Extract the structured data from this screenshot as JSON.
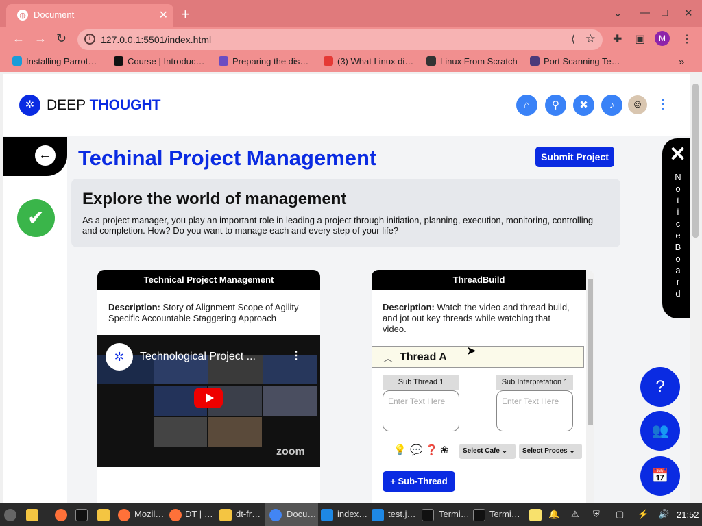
{
  "browser": {
    "tab_title": "Document",
    "url": "127.0.0.1:5501/index.html",
    "profile_initial": "M",
    "bookmarks": [
      "Installing Parrot…",
      "Course | Introduc…",
      "Preparing the dis…",
      "(3) What Linux di…",
      "Linux From Scratch",
      "Port Scanning Te…"
    ]
  },
  "header": {
    "brand_first": "DEEP",
    "brand_second": "THOUGHT"
  },
  "main": {
    "title": "Techinal Project Management",
    "submit_label": "Submit Project",
    "explore_heading": "Explore the world of management",
    "explore_text": "As a project manager, you play an important role in leading a project through initiation, planning, execution, monitoring, controlling and completion. How? Do you want to manage each and every step of your life?"
  },
  "card1": {
    "title": "Technical Project Management",
    "desc_label": "Description:",
    "desc_text": "Story of Alignment Scope of Agility Specific Accountable Staggering Approach",
    "video_title": "Technological Project ...",
    "video_brand": "zoom"
  },
  "card2": {
    "title": "ThreadBuild",
    "desc_label": "Description:",
    "desc_text": "Watch the video and thread build, and jot out key threads while watching that video.",
    "thread_title": "Thread A",
    "sub_thread_label": "Sub Thread 1",
    "sub_interp_label": "Sub Interpretation 1",
    "placeholder": "Enter Text Here",
    "select_cafe": "Select Cafe",
    "select_process": "Select Proces",
    "add_sub_thread": "+ Sub-Thread"
  },
  "notice_board": {
    "letters": "N o t i c e   B o a r d"
  },
  "taskbar": {
    "items": [
      "Mozil…",
      "DT | …",
      "dt-fr…",
      "Docu…",
      "index…",
      "test.j…",
      "Termi…",
      "Termi…"
    ],
    "time": "21:52"
  }
}
